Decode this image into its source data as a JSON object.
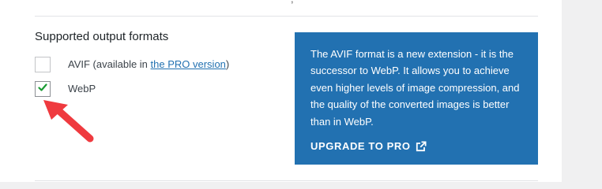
{
  "top_fragment": ",",
  "section": {
    "title": "Supported output formats"
  },
  "options": [
    {
      "label": "AVIF (available in ",
      "link_text": "the PRO version",
      "suffix": ")",
      "checked": false
    },
    {
      "label": "WebP",
      "checked": true
    }
  ],
  "info_box": {
    "text": "The AVIF format is a new extension - it is the successor to WebP. It allows you to achieve even higher levels of image compression, and the quality of the converted images is better than in WebP.",
    "link_label": "Upgrade to PRO",
    "icon": "external-link-icon"
  },
  "annotation": {
    "icon": "red-arrow-icon"
  },
  "colors": {
    "accent": "#2271b1",
    "check": "#1a9b33",
    "arrow": "#ef3a3f"
  }
}
